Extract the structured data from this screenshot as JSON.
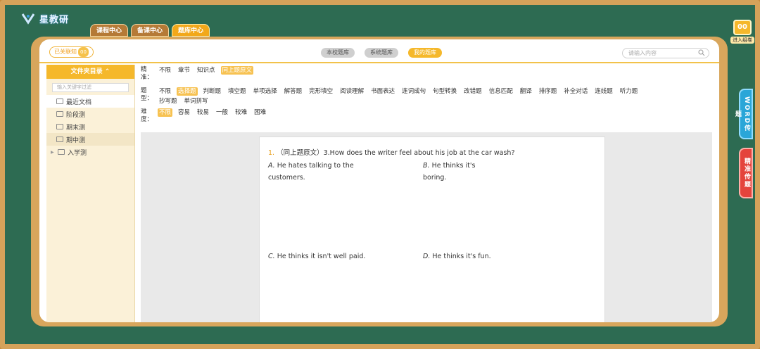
{
  "app": {
    "title": "星教研",
    "top_tabs": [
      "课程中心",
      "备课中心",
      "题库中心"
    ],
    "active_top_tab": 2
  },
  "side_actions": {
    "enter_label": "进入组卷",
    "enter_count": "00",
    "word_upload": "WORD传题",
    "precise_upload": "精准传题"
  },
  "header": {
    "known_label": "已关联知",
    "known_count": "00",
    "bank_tabs": [
      "本校题库",
      "系统题库",
      "我的题库"
    ],
    "active_bank_tab": 2,
    "search_placeholder": "请输入内容"
  },
  "sidebar": {
    "title": "文件夹目录",
    "filter_placeholder": "输入关键字过滤",
    "items": [
      {
        "label": "最近文档"
      },
      {
        "label": "阶段测"
      },
      {
        "label": "期末测"
      },
      {
        "label": "期中测"
      },
      {
        "label": "入学测"
      }
    ]
  },
  "filters": {
    "precise": {
      "label": "精准：",
      "options": [
        "不限",
        "章节",
        "知识点",
        "同上题原文"
      ],
      "selected": 3
    },
    "type": {
      "label": "题型：",
      "options": [
        "不限",
        "选择题",
        "判断题",
        "填空题",
        "单项选择",
        "解答题",
        "完形填空",
        "阅读理解",
        "书面表达",
        "连词成句",
        "句型转换",
        "改错题",
        "信息匹配",
        "翻译",
        "排序题",
        "补全对话",
        "连线题",
        "听力题",
        "抄写题",
        "单词拼写"
      ],
      "selected": 1
    },
    "difficulty": {
      "label": "难度：",
      "options": [
        "不限",
        "容易",
        "较易",
        "一般",
        "较难",
        "困难"
      ],
      "selected": 0
    }
  },
  "question": {
    "number": "1.",
    "text": "（同上题原文）3.How does the writer feel about his job at the car wash?",
    "options": [
      {
        "letter": "A.",
        "text": "He hates talking to the customers."
      },
      {
        "letter": "B.",
        "text": "He thinks it's boring."
      },
      {
        "letter": "C.",
        "text": "He thinks it isn't well paid."
      },
      {
        "letter": "D.",
        "text": "He thinks it's fun."
      }
    ]
  }
}
